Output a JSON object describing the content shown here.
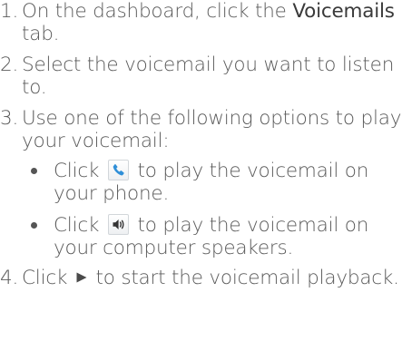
{
  "steps": [
    {
      "number": "1.",
      "pre": "On the dashboard, click the ",
      "bold": "Voicemails",
      "post": " tab."
    },
    {
      "number": "2.",
      "text": "Select the voicemail you want to listen to."
    },
    {
      "number": "3.",
      "text": "Use one of the following options to play your voicemail:",
      "options": [
        {
          "pre": "Click ",
          "icon": "phone-icon",
          "post": " to play the voicemail on your phone."
        },
        {
          "pre": "Click ",
          "icon": "speaker-icon",
          "post": " to play the voicemail on your computer speakers."
        }
      ]
    },
    {
      "number": "4.",
      "pre": "Click ",
      "icon": "play-icon",
      "post": " to start the voicemail playback."
    }
  ],
  "colors": {
    "text": "#5a5a5a",
    "phone_icon": "#2f8fd8",
    "icon_dark": "#333333"
  }
}
